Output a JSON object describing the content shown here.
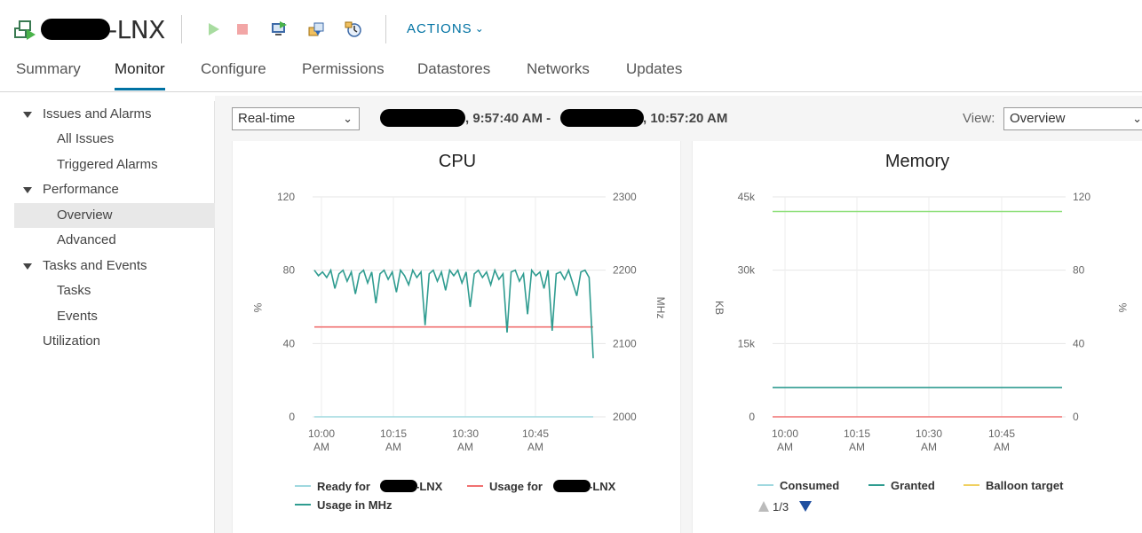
{
  "header": {
    "vm_name_suffix": "-LNX",
    "actions_label": "ACTIONS",
    "icons": [
      "vm-icon",
      "power-on-icon",
      "power-off-icon",
      "console-icon",
      "migrate-icon",
      "snapshot-icon"
    ]
  },
  "tabs": [
    {
      "label": "Summary",
      "active": false
    },
    {
      "label": "Monitor",
      "active": true
    },
    {
      "label": "Configure",
      "active": false
    },
    {
      "label": "Permissions",
      "active": false
    },
    {
      "label": "Datastores",
      "active": false
    },
    {
      "label": "Networks",
      "active": false
    },
    {
      "label": "Updates",
      "active": false
    }
  ],
  "nav": {
    "issues": "Issues and Alarms",
    "all_issues": "All Issues",
    "triggered_alarms": "Triggered Alarms",
    "performance": "Performance",
    "overview": "Overview",
    "advanced": "Advanced",
    "tasks_events": "Tasks and Events",
    "tasks": "Tasks",
    "events": "Events",
    "utilization": "Utilization"
  },
  "toolbar": {
    "period_value": "Real-time",
    "time_start": ", 9:57:40 AM -",
    "time_end": ", 10:57:20 AM",
    "view_label": "View:",
    "view_value": "Overview"
  },
  "cpu_chart": {
    "title": "CPU",
    "y_left_label": "%",
    "y_right_label": "MHz",
    "y_left_ticks": [
      "120",
      "80",
      "40",
      "0"
    ],
    "y_right_ticks": [
      "2300",
      "2200",
      "2100",
      "2000"
    ],
    "x_ticks": [
      [
        "10:00",
        "AM"
      ],
      [
        "10:15",
        "AM"
      ],
      [
        "10:30",
        "AM"
      ],
      [
        "10:45",
        "AM"
      ]
    ],
    "legend_ready": "Ready for",
    "legend_usage": "Usage for",
    "legend_suffix": "-LNX",
    "legend_mhz": "Usage in MHz",
    "colors": {
      "ready": "#9fd8df",
      "usage": "#f07070",
      "mhz": "#2f9c90"
    }
  },
  "memory_chart": {
    "title": "Memory",
    "y_left_label": "KB",
    "y_right_label": "%",
    "y_left_ticks": [
      "45k",
      "30k",
      "15k",
      "0"
    ],
    "y_right_ticks": [
      "120",
      "80",
      "40",
      "0"
    ],
    "x_ticks": [
      [
        "10:00",
        "AM"
      ],
      [
        "10:15",
        "AM"
      ],
      [
        "10:30",
        "AM"
      ],
      [
        "10:45",
        "AM"
      ]
    ],
    "legend_consumed": "Consumed",
    "legend_granted": "Granted",
    "legend_balloon": "Balloon target",
    "pager": "1/3",
    "colors": {
      "consumed": "#9fd8df",
      "granted": "#2f9c90",
      "balloon": "#f0d060",
      "green": "#8fe07a",
      "red": "#f07070"
    }
  },
  "chart_data": [
    {
      "type": "line",
      "title": "CPU",
      "x": [
        "10:00 AM",
        "10:15 AM",
        "10:30 AM",
        "10:45 AM"
      ],
      "ylabel": "%",
      "ylim": [
        0,
        120
      ],
      "y2label": "MHz",
      "y2lim": [
        2000,
        2300
      ],
      "series": [
        {
          "name": "Ready for -LNX",
          "axis": "left",
          "values": [
            0,
            0,
            0,
            0,
            0
          ]
        },
        {
          "name": "Usage for -LNX",
          "axis": "left",
          "values": [
            49,
            49,
            49,
            49,
            49
          ]
        },
        {
          "name": "Usage in MHz",
          "axis": "left",
          "values": [
            80,
            77,
            79,
            76,
            80,
            70,
            78,
            80,
            74,
            79,
            67,
            78,
            80,
            73,
            79,
            62,
            78,
            80,
            75,
            79,
            68,
            80,
            77,
            72,
            80,
            76,
            79,
            50,
            78,
            80,
            74,
            79,
            69,
            80,
            77,
            80,
            73,
            79,
            60,
            78,
            80,
            76,
            79,
            72,
            80,
            75,
            78,
            46,
            79,
            80,
            74,
            78,
            56,
            80,
            77,
            79,
            70,
            80,
            47,
            78,
            79,
            75,
            80,
            73,
            66,
            79,
            80,
            76,
            32
          ]
        }
      ],
      "legend": "bottom"
    },
    {
      "type": "line",
      "title": "Memory",
      "x": [
        "10:00 AM",
        "10:15 AM",
        "10:30 AM",
        "10:45 AM"
      ],
      "ylabel": "KB",
      "ylim": [
        0,
        45000
      ],
      "y2label": "%",
      "y2lim": [
        0,
        120
      ],
      "series": [
        {
          "name": "Consumed",
          "values": [
            42000,
            42000,
            42000,
            42000,
            42000
          ]
        },
        {
          "name": "Granted",
          "values": [
            6000,
            6000,
            6000,
            6000,
            6000
          ]
        },
        {
          "name": "Balloon target",
          "values": [
            0,
            0,
            0,
            0,
            0
          ]
        }
      ],
      "legend": "bottom"
    }
  ]
}
